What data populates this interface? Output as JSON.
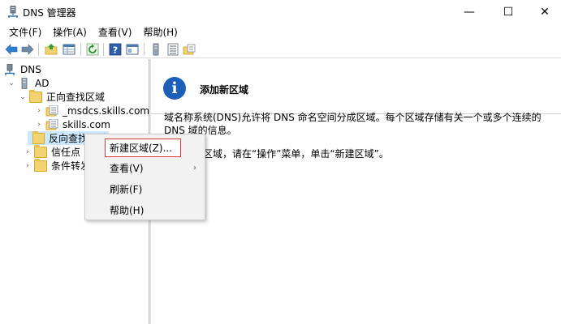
{
  "window": {
    "title": "DNS 管理器",
    "minimize_glyph": "—",
    "maximize_glyph": "☐",
    "close_glyph": "✕"
  },
  "menubar": {
    "items": [
      {
        "label": "文件(F)"
      },
      {
        "label": "操作(A)"
      },
      {
        "label": "查看(V)"
      },
      {
        "label": "帮助(H)"
      }
    ]
  },
  "toolbar": {
    "icons": [
      "back-arrow-icon",
      "forward-arrow-icon",
      "up-folder-icon",
      "properties-grid-icon",
      "refresh-icon",
      "help-icon",
      "view-pane-icon",
      "server-icon",
      "list-icon",
      "folder-zone-icon"
    ]
  },
  "tree": {
    "root": {
      "label": "DNS"
    },
    "server": {
      "label": "AD"
    },
    "forward_zones": {
      "label": "正向查找区域"
    },
    "zone_msdcs": {
      "label": "_msdcs.skills.com"
    },
    "zone_skills": {
      "label": "skills.com"
    },
    "reverse_zones": {
      "label": "反向查找区域"
    },
    "trust_points": {
      "label": "信任点"
    },
    "conditional_forwarders": {
      "label": "条件转发器"
    }
  },
  "content": {
    "title": "添加新区域",
    "paragraph1": "域名称系统(DNS)允许将 DNS 命名空间分成区域。每个区域存储有关一个或多个连续的 DNS 域的信息。",
    "paragraph2": "要添加新区域，请在“操作”菜单，单击“新建区域”。"
  },
  "context_menu": {
    "items": [
      {
        "label": "新建区域(Z)..."
      },
      {
        "label": "查看(V)",
        "submenu_glyph": "›"
      },
      {
        "label": "刷新(F)"
      },
      {
        "label": "帮助(H)"
      }
    ]
  },
  "colors": {
    "selection": "#cce8ff",
    "highlight_border": "#d9393e",
    "info_icon": "#1c5fb8"
  }
}
